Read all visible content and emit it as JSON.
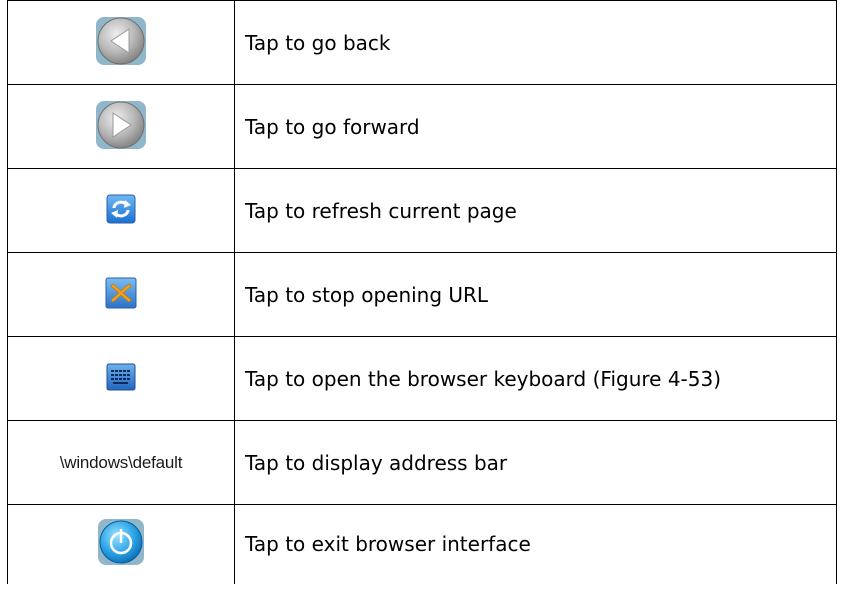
{
  "rows": [
    {
      "icon": "back-arrow-icon",
      "description": "Tap to go back"
    },
    {
      "icon": "forward-arrow-icon",
      "description": "Tap to go forward"
    },
    {
      "icon": "refresh-icon",
      "description": "Tap to refresh current page"
    },
    {
      "icon": "stop-icon",
      "description": "Tap to stop opening URL"
    },
    {
      "icon": "keyboard-icon",
      "description": "Tap to open the browser keyboard (Figure 4-53)"
    },
    {
      "icon": "address-bar-text",
      "address_text": "\\windows\\default",
      "description": "Tap to display address bar"
    },
    {
      "icon": "power-icon",
      "description": "Tap to exit browser interface"
    }
  ]
}
